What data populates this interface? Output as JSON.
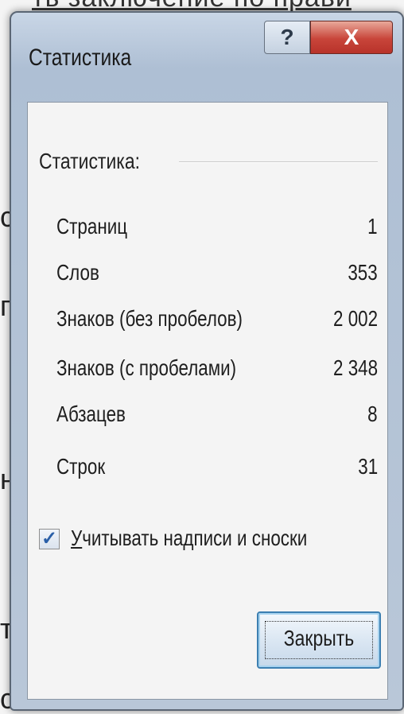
{
  "background": {
    "top_text": "ть заключение по прави",
    "fragments": [
      "с",
      "п",
      "н",
      "т",
      "с"
    ]
  },
  "window": {
    "title": "Статистика",
    "help_label": "?",
    "close_label": "X"
  },
  "stats": {
    "group_label": "Статистика:",
    "rows": [
      {
        "label": "Страниц",
        "value": "1"
      },
      {
        "label": "Слов",
        "value": "353"
      },
      {
        "label": "Знаков (без пробелов)",
        "value": "2 002"
      },
      {
        "label": "Знаков (с пробелами)",
        "value": "2 348"
      },
      {
        "label": "Абзацев",
        "value": "8"
      },
      {
        "label": "Строк",
        "value": "31"
      }
    ]
  },
  "options": {
    "include_textboxes_checked": true,
    "checkmark": "✓",
    "include_textboxes_label_first": "У",
    "include_textboxes_label_rest": "читывать надписи и сноски"
  },
  "buttons": {
    "close_label": "Закрыть"
  }
}
